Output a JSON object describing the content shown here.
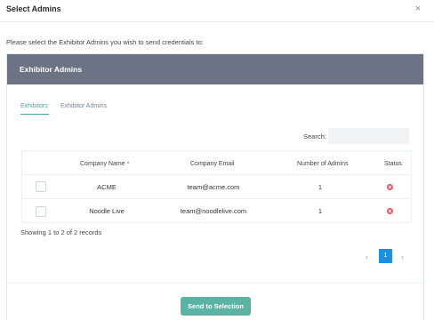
{
  "modal": {
    "title": "Select Admins",
    "close_glyph": "×",
    "instructions": "Please select the Exhibitor Admins you wish to send credentials to:"
  },
  "panel": {
    "title": "Exhibitor Admins",
    "tabs": [
      {
        "label": "Exhibitors",
        "active": true
      },
      {
        "label": "Exhibitor Admins",
        "active": false
      }
    ],
    "search": {
      "label": "Search:",
      "value": "",
      "placeholder": ""
    },
    "table": {
      "columns": [
        "",
        "Company Name",
        "Company Email",
        "Number of Admins",
        "Status"
      ],
      "sort_column": "Company Name",
      "sort_glyph": "^",
      "rows": [
        {
          "checked": false,
          "company_name": "ACME",
          "company_email": "team@acme.com",
          "number_of_admins": "1",
          "status": "x-circle-icon"
        },
        {
          "checked": false,
          "company_name": "Noodle Live",
          "company_email": "team@noodlelive.com",
          "number_of_admins": "1",
          "status": "x-circle-icon"
        }
      ]
    },
    "records_text": "Showing 1 to 2 of 2 records",
    "pagination": {
      "prev_glyph": "‹",
      "current_page": "1",
      "next_glyph": "›"
    },
    "send_button_label": "Send to Selection"
  },
  "colors": {
    "panel_header": "#6b7385",
    "accent_teal": "#4aa89a",
    "send_button": "#5bb3a4",
    "page_active": "#1e8fe0",
    "status_error": "#e2485a"
  }
}
